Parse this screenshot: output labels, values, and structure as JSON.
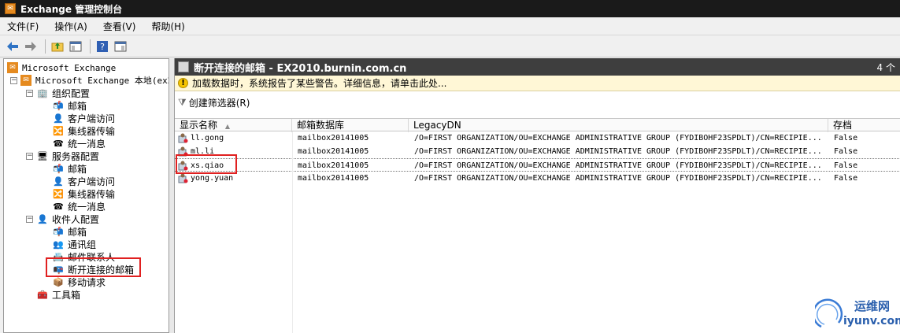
{
  "window": {
    "title": "Exchange 管理控制台"
  },
  "menu": {
    "file": "文件(F)",
    "action": "操作(A)",
    "view": "查看(V)",
    "help": "帮助(H)"
  },
  "tree": {
    "root": "Microsoft Exchange",
    "local": "Microsoft Exchange 本地(ex20",
    "org_config": "组织配置",
    "org_mailbox": "邮箱",
    "org_client_access": "客户端访问",
    "org_hub": "集线器传输",
    "org_um": "统一消息",
    "server_config": "服务器配置",
    "srv_mailbox": "邮箱",
    "srv_client_access": "客户端访问",
    "srv_hub": "集线器传输",
    "srv_um": "统一消息",
    "recipient_config": "收件人配置",
    "rcp_mailbox": "邮箱",
    "rcp_group": "通讯组",
    "rcp_contact": "邮件联系人",
    "rcp_disconnected": "断开连接的邮箱",
    "rcp_move": "移动请求",
    "toolbox": "工具箱"
  },
  "panel": {
    "title": "断开连接的邮箱 - EX2010.burnin.com.cn",
    "count": "4 个",
    "warning": "加载数据时，系统报告了某些警告。详细信息，请单击此处...",
    "filter": "创建筛选器(R)"
  },
  "table": {
    "headers": [
      "显示名称",
      "邮箱数据库",
      "LegacyDN",
      "存档"
    ],
    "rows": [
      [
        "ll.gong",
        "mailbox20141005",
        "/O=FIRST ORGANIZATION/OU=EXCHANGE ADMINISTRATIVE GROUP (FYDIBOHF23SPDLT)/CN=RECIPIE...",
        "False"
      ],
      [
        "ml.li",
        "mailbox20141005",
        "/O=FIRST ORGANIZATION/OU=EXCHANGE ADMINISTRATIVE GROUP (FYDIBOHF23SPDLT)/CN=RECIPIE...",
        "False"
      ],
      [
        "xs.qiao",
        "mailbox20141005",
        "/O=FIRST ORGANIZATION/OU=EXCHANGE ADMINISTRATIVE GROUP (FYDIBOHF23SPDLT)/CN=RECIPIE...",
        "False"
      ],
      [
        "yong.yuan",
        "mailbox20141005",
        "/O=FIRST ORGANIZATION/OU=EXCHANGE ADMINISTRATIVE GROUP (FYDIBOHF23SPDLT)/CN=RECIPIE...",
        "False"
      ]
    ]
  },
  "watermark": {
    "cn": "运维网",
    "url": "iyunv.com"
  },
  "colors": {
    "highlight": "#e02020",
    "title_bg": "#1a1a1a",
    "header_bg": "#3e3e3e",
    "warning_bg": "#fff7d6"
  }
}
